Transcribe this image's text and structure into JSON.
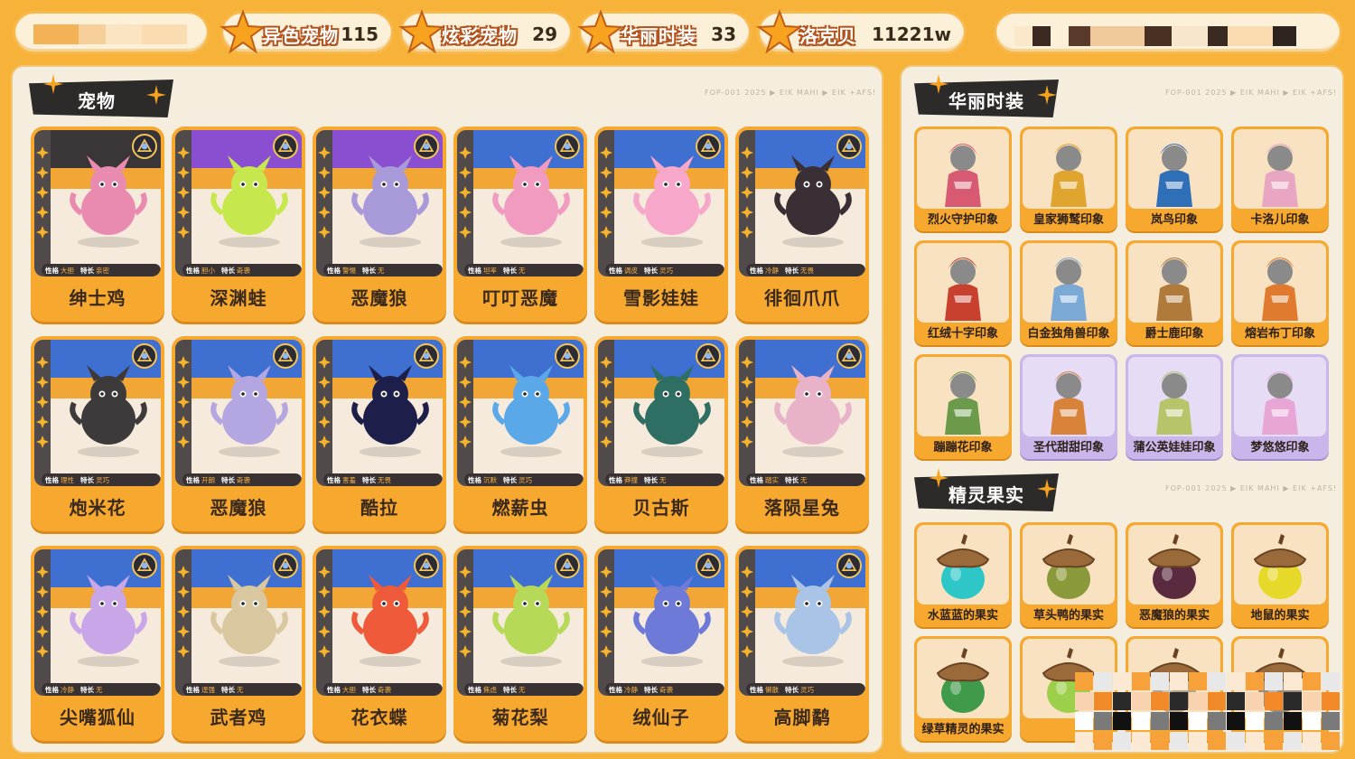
{
  "stats": [
    {
      "label": "异色宠物",
      "value": "115"
    },
    {
      "label": "炫彩宠物",
      "value": "29"
    },
    {
      "label": "华丽时装",
      "value": "33"
    },
    {
      "label": "洛克贝",
      "value": "11221w"
    }
  ],
  "left_panel": {
    "title": "宠物",
    "stamp": "FOP-001 2025 ▶ EIK MAHI ▶ EIK +AFS!"
  },
  "pets": [
    {
      "name": "绅士鸡",
      "trait_key": "性格",
      "trait": "大胆",
      "skill_key": "特长",
      "skill": "亲密",
      "theme": "dark",
      "color": "#e98bb0"
    },
    {
      "name": "深渊蛙",
      "trait_key": "性格",
      "trait": "胆小",
      "skill_key": "特长",
      "skill": "奇袭",
      "theme": "purple",
      "color": "#c7e84d"
    },
    {
      "name": "恶魔狼",
      "trait_key": "性格",
      "trait": "警惕",
      "skill_key": "特长",
      "skill": "无",
      "theme": "purple",
      "color": "#a89ad8"
    },
    {
      "name": "叮叮恶魔",
      "trait_key": "性格",
      "trait": "坦率",
      "skill_key": "特长",
      "skill": "无",
      "theme": "blue",
      "color": "#f29bc0"
    },
    {
      "name": "雪影娃娃",
      "trait_key": "性格",
      "trait": "调皮",
      "skill_key": "特长",
      "skill": "灵巧",
      "theme": "blue",
      "color": "#f7a7c9"
    },
    {
      "name": "徘徊爪爪",
      "trait_key": "性格",
      "trait": "冷静",
      "skill_key": "特长",
      "skill": "无畏",
      "theme": "blue",
      "color": "#3a2f35"
    },
    {
      "name": "炮米花",
      "trait_key": "性格",
      "trait": "理性",
      "skill_key": "特长",
      "skill": "灵巧",
      "theme": "blue",
      "color": "#3c3a3a"
    },
    {
      "name": "恶魔狼",
      "trait_key": "性格",
      "trait": "开朗",
      "skill_key": "特长",
      "skill": "奇袭",
      "theme": "blue",
      "color": "#b4a6e0"
    },
    {
      "name": "酷拉",
      "trait_key": "性格",
      "trait": "害羞",
      "skill_key": "特长",
      "skill": "无畏",
      "theme": "blue",
      "color": "#1d1f4a"
    },
    {
      "name": "燃薪虫",
      "trait_key": "性格",
      "trait": "沉默",
      "skill_key": "特长",
      "skill": "灵巧",
      "theme": "blue",
      "color": "#5aa8e8"
    },
    {
      "name": "贝古斯",
      "trait_key": "性格",
      "trait": "莽撞",
      "skill_key": "特长",
      "skill": "无",
      "theme": "blue",
      "color": "#2f6f63"
    },
    {
      "name": "落陨星兔",
      "trait_key": "性格",
      "trait": "踏实",
      "skill_key": "特长",
      "skill": "无",
      "theme": "blue",
      "color": "#e8b3c8"
    },
    {
      "name": "尖嘴狐仙",
      "trait_key": "性格",
      "trait": "冷静",
      "skill_key": "特长",
      "skill": "无",
      "theme": "blue",
      "color": "#c9a6e8"
    },
    {
      "name": "武者鸡",
      "trait_key": "性格",
      "trait": "逞强",
      "skill_key": "特长",
      "skill": "无",
      "theme": "blue",
      "color": "#d9c7a0"
    },
    {
      "name": "花衣蝶",
      "trait_key": "性格",
      "trait": "大胆",
      "skill_key": "特长",
      "skill": "奇袭",
      "theme": "blue",
      "color": "#ef5a3a"
    },
    {
      "name": "菊花梨",
      "trait_key": "性格",
      "trait": "焦虑",
      "skill_key": "特长",
      "skill": "无",
      "theme": "blue",
      "color": "#b6d957"
    },
    {
      "name": "绒仙子",
      "trait_key": "性格",
      "trait": "冷静",
      "skill_key": "特长",
      "skill": "奇袭",
      "theme": "blue",
      "color": "#6d7ad8"
    },
    {
      "name": "高脚鹬",
      "trait_key": "性格",
      "trait": "懒散",
      "skill_key": "特长",
      "skill": "灵巧",
      "theme": "blue",
      "color": "#a9c4e6"
    }
  ],
  "outfit_section": {
    "title": "华丽时装",
    "stamp": "FOP-001 2025 ▶ EIK MAHI ▶ EIK +AFS!"
  },
  "outfits": [
    {
      "name": "烈火守护印象",
      "color": "#d85a72",
      "style": "orange"
    },
    {
      "name": "皇家狮鹫印象",
      "color": "#e0a52e",
      "style": "orange"
    },
    {
      "name": "岚鸟印象",
      "color": "#2f6fb8",
      "style": "orange"
    },
    {
      "name": "卡洛儿印象",
      "color": "#e9a6c2",
      "style": "orange"
    },
    {
      "name": "红绒十字印象",
      "color": "#c8412e",
      "style": "orange"
    },
    {
      "name": "白金独角兽印象",
      "color": "#7aa9d6",
      "style": "orange"
    },
    {
      "name": "爵士鹿印象",
      "color": "#b07a3a",
      "style": "orange"
    },
    {
      "name": "熔岩布丁印象",
      "color": "#e07a2f",
      "style": "orange"
    },
    {
      "name": "蹦蹦花印象",
      "color": "#6a9a4a",
      "style": "orange"
    },
    {
      "name": "圣代甜甜印象",
      "color": "#d9823a",
      "style": "lilac"
    },
    {
      "name": "蒲公英娃娃印象",
      "color": "#b8c46a",
      "style": "lilac"
    },
    {
      "name": "梦悠悠印象",
      "color": "#e8a6d6",
      "style": "lilac"
    }
  ],
  "fruit_section": {
    "title": "精灵果实",
    "stamp": "FOP-001 2025 ▶ EIK MAHI ▶ EIK +AFS!"
  },
  "fruits": [
    {
      "name": "水蓝蓝的果实",
      "color": "#2fc6c8"
    },
    {
      "name": "草头鸭的果实",
      "color": "#8a9a3a"
    },
    {
      "name": "恶魔狼的果实",
      "color": "#5a2a3e"
    },
    {
      "name": "地鼠的果实",
      "color": "#e6d92a"
    },
    {
      "name": "绿草精灵的果实",
      "color": "#3f9a4a"
    },
    {
      "name": "",
      "color": "#9ccf4a"
    },
    {
      "name": "",
      "color": "#b5a38a"
    },
    {
      "name": "",
      "color": "#9a8a7a"
    }
  ]
}
